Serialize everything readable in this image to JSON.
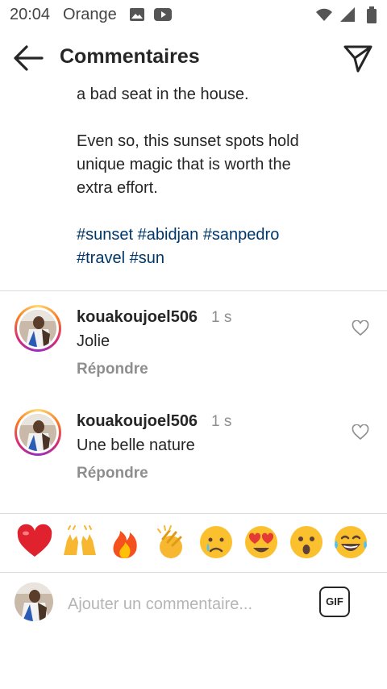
{
  "status_bar": {
    "time": "20:04",
    "carrier": "Orange",
    "icons": [
      "image-icon",
      "youtube-icon",
      "wifi-icon",
      "signal-icon",
      "battery-icon"
    ]
  },
  "app_bar": {
    "title": "Commentaires",
    "back_icon": "arrow-left-icon",
    "send_icon": "paper-plane-icon"
  },
  "caption": {
    "line1": "a bad seat in the house.",
    "paragraph": [
      "Even so, this sunset spots hold",
      "unique magic that is worth the",
      "extra effort."
    ],
    "hashtags_line1": [
      "#sunset",
      "#abidjan",
      "#sanpedro"
    ],
    "hashtags_line2": [
      "#travel",
      "#sun"
    ]
  },
  "comments": [
    {
      "username": "kouakoujoel506",
      "time": "1 s",
      "text": "Jolie",
      "reply_label": "Répondre"
    },
    {
      "username": "kouakoujoel506",
      "time": "1 s",
      "text": "Une belle nature",
      "reply_label": "Répondre"
    }
  ],
  "emoji_bar": [
    "❤️",
    "🙌",
    "🔥",
    "👏",
    "😢",
    "😍",
    "😮",
    "😂"
  ],
  "composer": {
    "placeholder": "Ajouter un commentaire...",
    "gif_label": "GIF"
  },
  "colors": {
    "text": "#262626",
    "secondary": "#8e8e8e",
    "hashtag": "#00376b",
    "divider": "#dbdbdb"
  }
}
